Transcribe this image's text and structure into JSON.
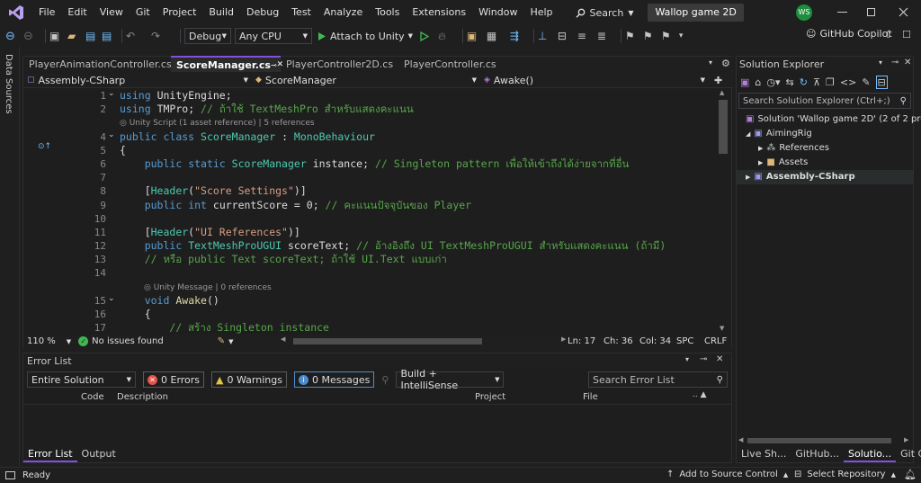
{
  "menu": [
    "File",
    "Edit",
    "View",
    "Git",
    "Project",
    "Build",
    "Debug",
    "Test",
    "Analyze",
    "Tools",
    "Extensions",
    "Window",
    "Help"
  ],
  "search_label": "Search",
  "window_title": "Wallop game 2D",
  "user_initials": "WS",
  "toolbar": {
    "config": "Debug",
    "platform": "Any CPU",
    "attach": "Attach to Unity",
    "copilot": "GitHub Copilot"
  },
  "side_label": "Data Sources",
  "doc_tabs": [
    "PlayerAnimationController.cs",
    "ScoreManager.cs",
    "PlayerController2D.cs",
    "PlayerController.cs"
  ],
  "nav": {
    "project": "Assembly-CSharp",
    "class": "ScoreManager",
    "member": "Awake()"
  },
  "code": [
    {
      "n": "1",
      "html": "<span class=\"kw\">using</span> <span class=\"id\">UnityEngine</span>;"
    },
    {
      "n": "2",
      "html": "<span class=\"kw\">using</span> <span class=\"id\">TMPro</span>; <span class=\"cm\">// ถ้าใช้ TextMeshPro สำหรับแสดงคะแนน</span>"
    },
    {
      "lens": "Unity Script (1 asset reference) | 5 references"
    },
    {
      "n": "4",
      "html": "<span class=\"kw\">public</span> <span class=\"kw\">class</span> <span class=\"ty\">ScoreManager</span> : <span class=\"ty\">MonoBehaviour</span>"
    },
    {
      "n": "5",
      "html": "{"
    },
    {
      "n": "6",
      "html": "    <span class=\"kw\">public</span> <span class=\"kw\">static</span> <span class=\"ty\">ScoreManager</span> instance; <span class=\"cm\">// Singleton pattern เพื่อให้เข้าถึงได้ง่ายจากที่อื่น</span>"
    },
    {
      "n": "7",
      "html": ""
    },
    {
      "n": "8",
      "html": "    [<span class=\"ty\">Header</span>(<span class=\"st\">\"Score Settings\"</span>)]"
    },
    {
      "n": "9",
      "html": "    <span class=\"kw\">public</span> <span class=\"kw\">int</span> currentScore = <span class=\"id\">0</span>; <span class=\"cm\">// คะแนนปัจจุบันของ Player</span>"
    },
    {
      "n": "10",
      "html": ""
    },
    {
      "n": "11",
      "html": "    [<span class=\"ty\">Header</span>(<span class=\"st\">\"UI References\"</span>)]"
    },
    {
      "n": "12",
      "html": "    <span class=\"kw\">public</span> <span class=\"ty\">TextMeshProUGUI</span> scoreText; <span class=\"cm\">// อ้างอิงถึง UI TextMeshProUGUI สำหรับแสดงคะแนน (ถ้ามี)</span>"
    },
    {
      "n": "13",
      "html": "    <span class=\"cm\">// หรือ public Text scoreText; ถ้าใช้ UI.Text แบบเก่า</span>"
    },
    {
      "n": "14",
      "html": ""
    },
    {
      "lens": "Unity Message | 0 references"
    },
    {
      "n": "15",
      "html": "    <span class=\"kw\">void</span> <span class=\"fn\">Awake</span>()"
    },
    {
      "n": "16",
      "html": "    {"
    },
    {
      "n": "17",
      "html": "        <span class=\"cm\">// สร้าง Singleton instance</span>"
    }
  ],
  "editor_status": {
    "zoom": "110 %",
    "issues": "No issues found",
    "ln": "Ln: 17",
    "ch": "Ch: 36",
    "col": "Col: 34",
    "spc": "SPC",
    "crlf": "CRLF"
  },
  "error_list": {
    "title": "Error List",
    "scope": "Entire Solution",
    "errors": "0 Errors",
    "warnings": "0 Warnings",
    "messages": "0 Messages",
    "build": "Build + IntelliSense",
    "search": "Search Error List",
    "cols": [
      "Code",
      "Description",
      "Project",
      "File"
    ]
  },
  "bottom_tabs": [
    "Error List",
    "Output"
  ],
  "solution": {
    "title": "Solution Explorer",
    "search": "Search Solution Explorer (Ctrl+;)",
    "items": [
      "Solution 'Wallop game 2D' (2 of 2 projects)",
      "AimingRig",
      "References",
      "Assets",
      "Assembly-CSharp"
    ]
  },
  "right_tabs": [
    "Live Sh...",
    "GitHub...",
    "Solutio...",
    "Git Cha..."
  ],
  "status": {
    "ready": "Ready",
    "source": "Add to Source Control",
    "repo": "Select Repository"
  },
  "colors": {
    "accent": "#8250df",
    "status_bar": "#1f1f1f",
    "active_tab": "#2b2b2b"
  }
}
